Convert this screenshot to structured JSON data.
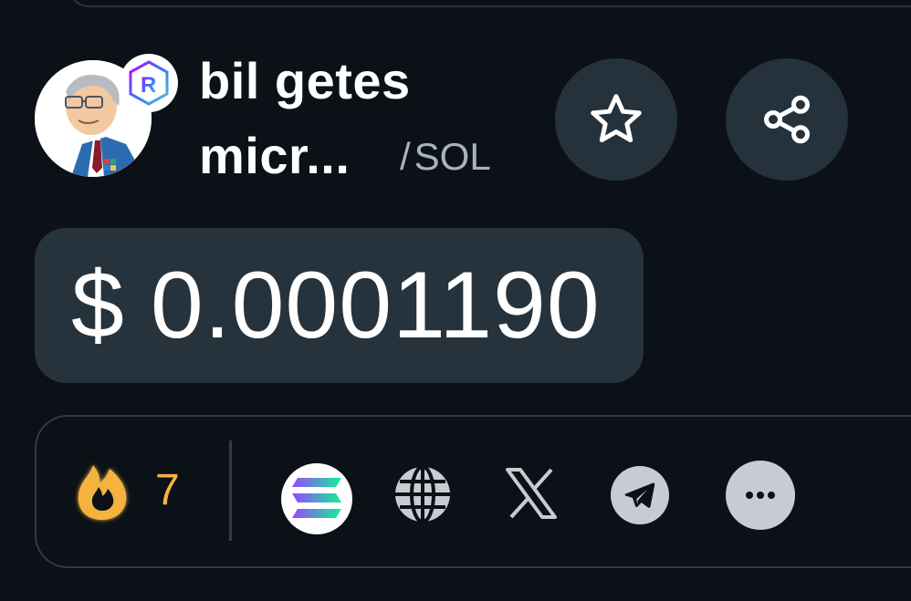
{
  "token": {
    "name_line1": "bil getes",
    "name_line2": "micr...",
    "pair_separator": "/",
    "pair_quote": "SOL",
    "badge_letter": "R"
  },
  "actions": {
    "favorite_icon": "star-icon",
    "share_icon": "share-icon"
  },
  "price": {
    "currency": "$",
    "value": "0.0001190"
  },
  "stats": {
    "fire_icon": "fire-icon",
    "fire_count": "7"
  },
  "links": [
    {
      "name": "solana-icon"
    },
    {
      "name": "globe-icon"
    },
    {
      "name": "x-icon"
    },
    {
      "name": "telegram-icon"
    },
    {
      "name": "more-icon"
    }
  ],
  "colors": {
    "background": "#0b1116",
    "card": "#26333c",
    "accent_fire": "#f4b341",
    "muted_text": "#a8b3bd",
    "icon_light": "#c7ccd3"
  }
}
